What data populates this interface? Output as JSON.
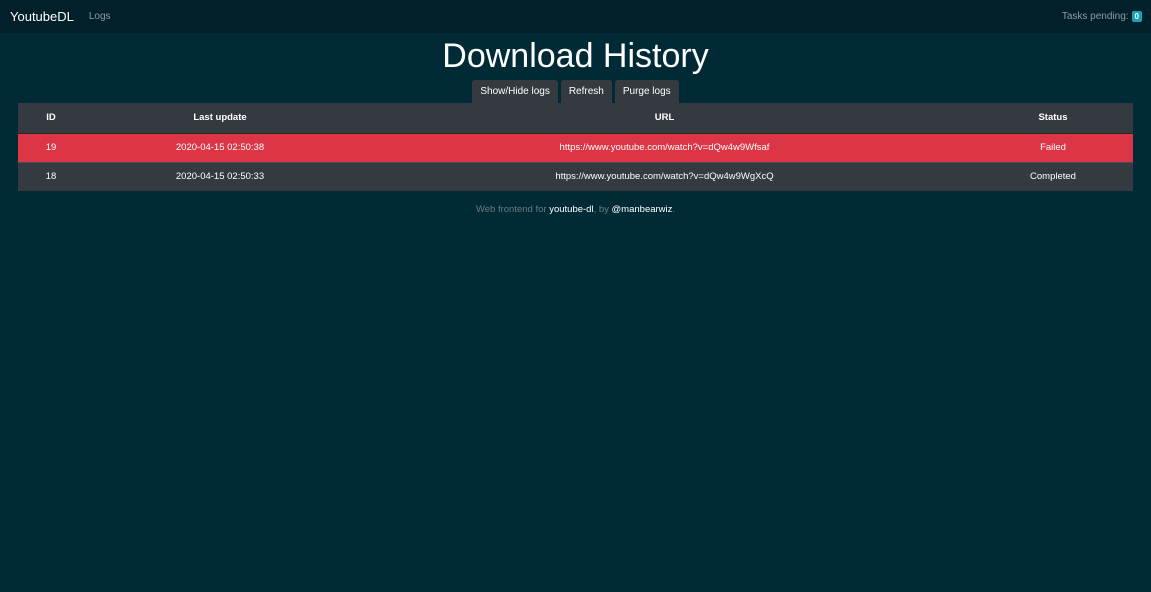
{
  "navbar": {
    "brand": "YoutubeDL",
    "logs_link": "Logs",
    "tasks_label": "Tasks pending:",
    "tasks_count": "0"
  },
  "page_title": "Download History",
  "toolbar": {
    "show_hide": "Show/Hide logs",
    "refresh": "Refresh",
    "purge": "Purge logs"
  },
  "table": {
    "headers": {
      "id": "ID",
      "last_update": "Last update",
      "url": "URL",
      "status": "Status"
    },
    "rows": [
      {
        "id": "19",
        "last_update": "2020-04-15 02:50:38",
        "url": "https://www.youtube.com/watch?v=dQw4w9Wfsaf",
        "status": "Failed"
      },
      {
        "id": "18",
        "last_update": "2020-04-15 02:50:33",
        "url": "https://www.youtube.com/watch?v=dQw4w9WgXcQ",
        "status": "Completed"
      }
    ]
  },
  "footer": {
    "prefix": "Web frontend for",
    "project_link": "youtube-dl",
    "by": ", by",
    "author_link": "@manbearwiz",
    "suffix": "."
  },
  "colors": {
    "background": "#002b36",
    "navbar": "#01202a",
    "failed_row": "#dc3545",
    "row": "#343a40",
    "badge": "#17a2b8"
  }
}
